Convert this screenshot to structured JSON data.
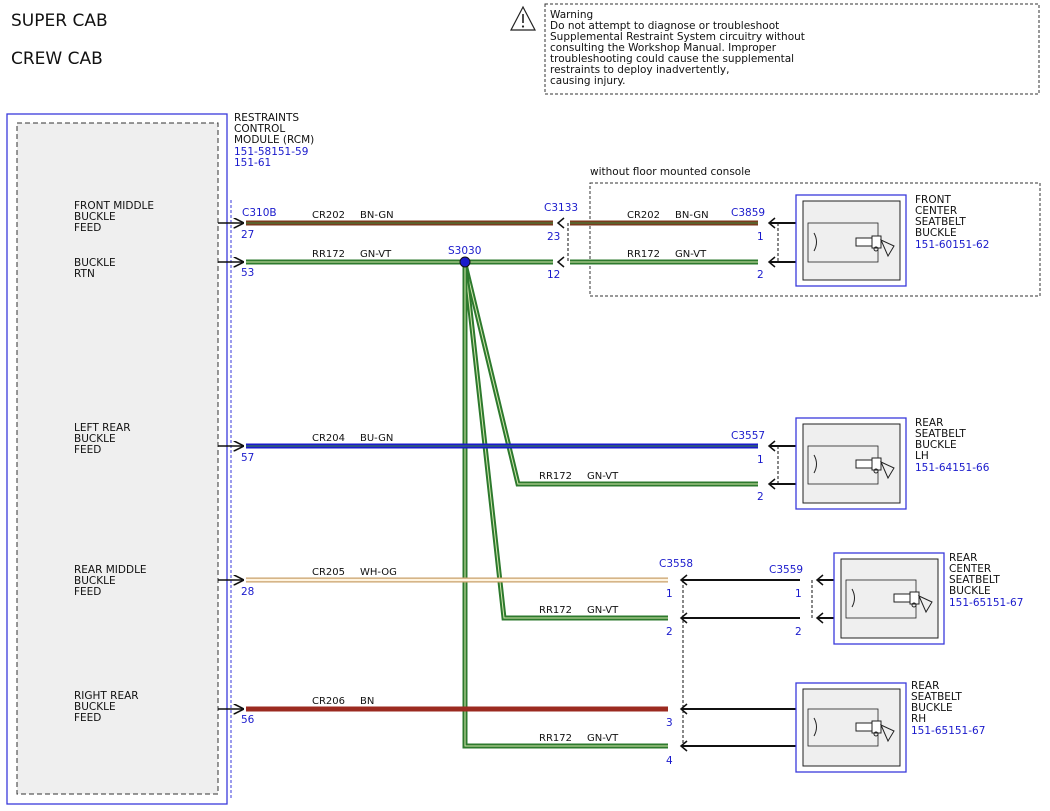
{
  "headers": [
    "SUPER CAB",
    "CREW CAB"
  ],
  "warning": {
    "lines": [
      "Warning",
      "Do not attempt to diagnose or troubleshoot",
      "Supplemental Restraint System circuitry without",
      "consulting the Workshop Manual. Improper",
      "troubleshooting could cause the supplemental",
      "restraints to deploy inadvertently,",
      "causing injury."
    ]
  },
  "rcm": {
    "name_lines": [
      "RESTRAINTS",
      "CONTROL",
      "MODULE (RCM)"
    ],
    "ref_lines": [
      "151-58151-59",
      "151-61"
    ],
    "functions": [
      {
        "lines": [
          "FRONT MIDDLE",
          "BUCKLE",
          "FEED"
        ]
      },
      {
        "lines": [
          "BUCKLE",
          "RTN"
        ]
      },
      {
        "lines": [
          "LEFT REAR",
          "BUCKLE",
          "FEED"
        ]
      },
      {
        "lines": [
          "REAR MIDDLE",
          "BUCKLE",
          "FEED"
        ]
      },
      {
        "lines": [
          "RIGHT REAR",
          "BUCKLE",
          "FEED"
        ]
      }
    ]
  },
  "connector_labels": {
    "C310B": "C310B",
    "C3133": "C3133",
    "C3859": "C3859",
    "C3557": "C3557",
    "C3558": "C3558",
    "C3559": "C3559",
    "S3030": "S3030"
  },
  "pins": {
    "p27": "27",
    "p53": "53",
    "p57": "57",
    "p28": "28",
    "p56": "56",
    "p23": "23",
    "p12": "12",
    "c3859_1": "1",
    "c3859_2": "2",
    "c3557_1": "1",
    "c3557_2": "2",
    "c3558_1": "1",
    "c3558_2": "2",
    "c3558_3": "3",
    "c3558_4": "4",
    "c3559_1": "1",
    "c3559_2": "2"
  },
  "circuits": {
    "w1": {
      "circuit": "CR202",
      "color": "BN-GN"
    },
    "w2": {
      "circuit": "CR202",
      "color": "BN-GN"
    },
    "w3": {
      "circuit": "RR172",
      "color": "GN-VT"
    },
    "w4": {
      "circuit": "RR172",
      "color": "GN-VT"
    },
    "w5": {
      "circuit": "CR204",
      "color": "BU-GN"
    },
    "w6": {
      "circuit": "RR172",
      "color": "GN-VT"
    },
    "w7": {
      "circuit": "CR205",
      "color": "WH-OG"
    },
    "w8": {
      "circuit": "RR172",
      "color": "GN-VT"
    },
    "w9": {
      "circuit": "CR206",
      "color": "BN"
    },
    "w10": {
      "circuit": "RR172",
      "color": "GN-VT"
    }
  },
  "console_note": "without floor mounted console",
  "components": {
    "front_center": {
      "lines": [
        "FRONT",
        "CENTER",
        "SEATBELT",
        "BUCKLE"
      ],
      "ref": "151-60151-62"
    },
    "rear_lh": {
      "lines": [
        "REAR",
        "SEATBELT",
        "BUCKLE",
        "LH"
      ],
      "ref": "151-64151-66"
    },
    "rear_center": {
      "lines": [
        "REAR",
        "CENTER",
        "SEATBELT",
        "BUCKLE"
      ],
      "ref": "151-65151-67"
    },
    "rear_rh": {
      "lines": [
        "REAR",
        "SEATBELT",
        "BUCKLE",
        "RH"
      ],
      "ref": "151-65151-67"
    }
  },
  "colors": {
    "brown": "#7a3a1e",
    "green": "#2d7a2d",
    "blue": "#1a1acc",
    "red_brown": "#9b2a20",
    "wh_og": "#f3d9a8",
    "connector_blue": "#1a1acc",
    "box_fill": "#efefef"
  },
  "icons": [
    "warning-triangle-icon",
    "seatbelt-buckle-icon"
  ]
}
